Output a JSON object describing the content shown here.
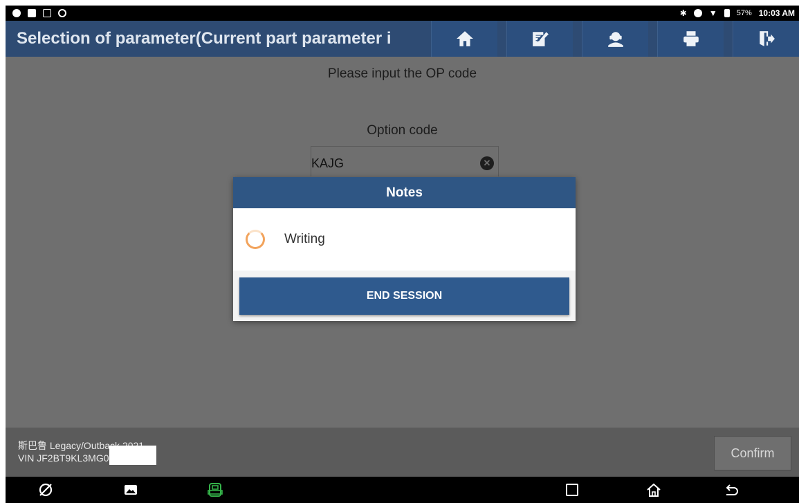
{
  "status_bar": {
    "battery": "57%",
    "time": "10:03 AM"
  },
  "header": {
    "title": "Selection of parameter(Current part parameter i",
    "buttons": [
      "home-icon",
      "edit-report-icon",
      "user-support-icon",
      "print-icon",
      "exit-icon"
    ]
  },
  "main": {
    "prompt": "Please input the OP code",
    "option_label": "Option code",
    "option_value": "KAJG"
  },
  "dialog": {
    "title": "Notes",
    "message": "Writing",
    "end_button": "END SESSION"
  },
  "footer": {
    "vehicle": "斯巴鲁 Legacy/Outback 2021",
    "vin": "VIN JF2BT9KL3MG0",
    "confirm": "Confirm"
  },
  "nav": [
    "browser-icon",
    "gallery-icon",
    "vci-icon",
    "recent-apps-icon",
    "home-nav-icon",
    "back-icon"
  ],
  "colors": {
    "header": "#2e4b73",
    "dialog_header": "#2f5684",
    "button": "#2f5a8e",
    "spinner": "#f2a35c",
    "vci": "#35b34a"
  }
}
